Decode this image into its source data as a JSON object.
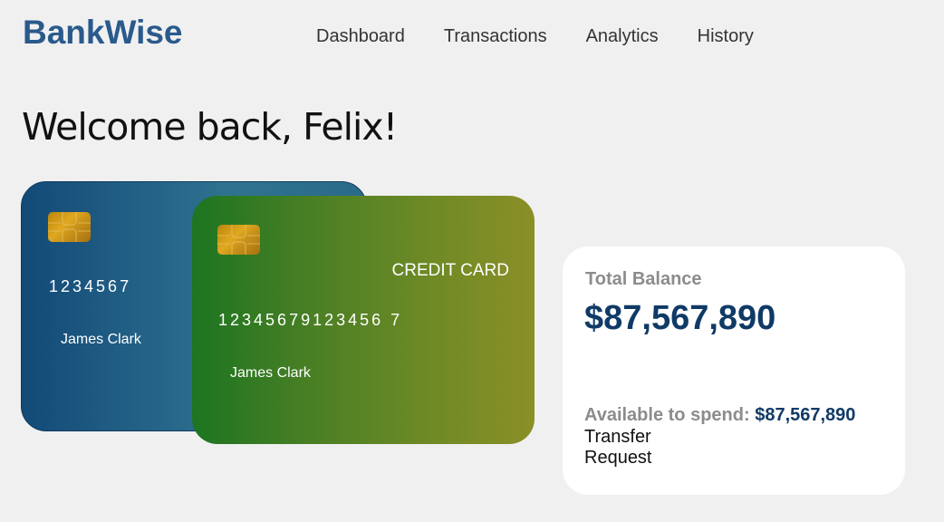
{
  "app": {
    "logo": "BankWise"
  },
  "nav": {
    "items": [
      {
        "label": "Dashboard"
      },
      {
        "label": "Transactions"
      },
      {
        "label": "Analytics"
      },
      {
        "label": "History"
      }
    ]
  },
  "welcome": {
    "text": "Welcome back, Felix!"
  },
  "cards": {
    "back": {
      "number": "1234567",
      "holder": "James Clark",
      "colors": [
        "#134a78",
        "#2f7290"
      ]
    },
    "front": {
      "type": "CREDIT CARD",
      "number": "12345679123456 7",
      "holder": "James Clark",
      "colors": [
        "#1c7521",
        "#8b8f27"
      ]
    },
    "chip_icon": "card-chip-icon"
  },
  "balance": {
    "label": "Total Balance",
    "value": "$87,567,890",
    "available_label": "Available to spend:",
    "available_value": "$87,567,890",
    "actions": {
      "transfer": "Transfer",
      "request": "Request"
    },
    "accent_color": "#0f3a66"
  }
}
